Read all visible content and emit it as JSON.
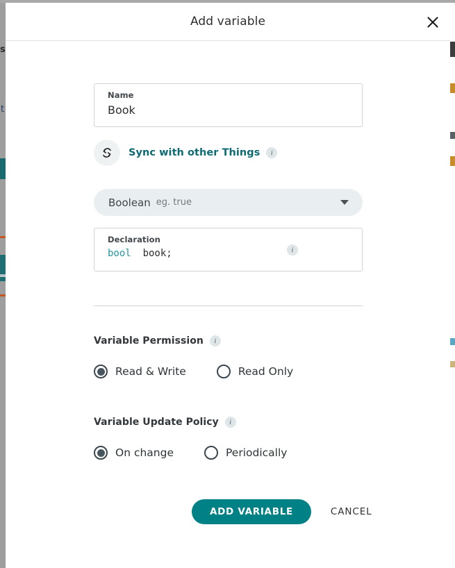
{
  "dialog": {
    "title": "Add variable",
    "close_icon": "close-icon"
  },
  "name_field": {
    "label": "Name",
    "value": "Book",
    "placeholder": "Name"
  },
  "sync": {
    "icon": "sync-icon",
    "label": "Sync with other Things",
    "info_icon": "i"
  },
  "type_select": {
    "value": "Boolean",
    "hint": "eg. true",
    "caret_icon": "chevron-down-icon"
  },
  "declaration": {
    "label": "Declaration",
    "type_keyword": "bool",
    "variable_name": "book",
    "terminator": ";",
    "info_icon": "i"
  },
  "permission": {
    "title": "Variable Permission",
    "info_icon": "i",
    "options": [
      {
        "label": "Read & Write",
        "selected": true
      },
      {
        "label": "Read Only",
        "selected": false
      }
    ]
  },
  "update_policy": {
    "title": "Variable Update Policy",
    "info_icon": "i",
    "options": [
      {
        "label": "On change",
        "selected": true
      },
      {
        "label": "Periodically",
        "selected": false
      }
    ]
  },
  "actions": {
    "submit_label": "ADD VARIABLE",
    "cancel_label": "CANCEL"
  },
  "colors": {
    "accent_teal": "#008185",
    "link_teal": "#0e6b73",
    "code_type": "#2196a3",
    "radio_selected": "#46555e",
    "select_background": "#e9eff0",
    "border": "#cfd4d6"
  },
  "background_page": {
    "left_text_1": "s",
    "left_text_2": "t"
  }
}
